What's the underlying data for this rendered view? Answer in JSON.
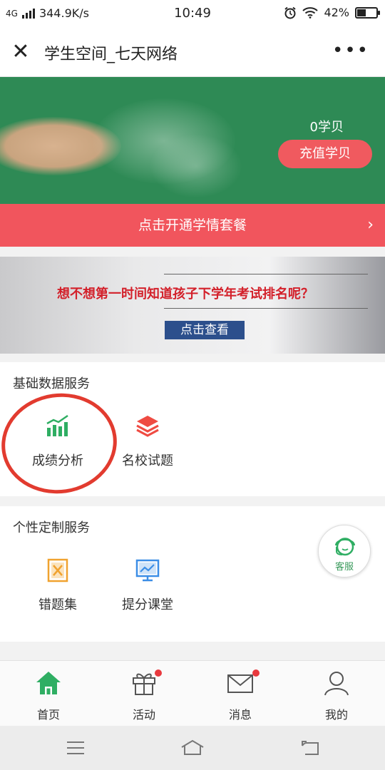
{
  "status_bar": {
    "network": "4G",
    "speed": "344.9K/s",
    "time": "10:49",
    "battery": "42%",
    "battery_level": 0.42,
    "icons": [
      "signal-icon",
      "alarm-icon",
      "wifi-icon",
      "battery-icon"
    ]
  },
  "titlebar": {
    "title": "学生空间_七天网络",
    "close_icon": "close-icon",
    "more_icon": "more-icon"
  },
  "banner": {
    "coins": "0学贝",
    "recharge_label": "充值学贝",
    "colors": {
      "background": "#2e8a55",
      "button": "#f05a5f"
    }
  },
  "promo": {
    "label": "点击开通学情套餐",
    "chevron_icon": "chevron-right-icon",
    "color": "#f1555d"
  },
  "ad": {
    "headline": "想不想第一时间知道孩子下学年考试排名呢？",
    "cta": "点击查看"
  },
  "basic_services": {
    "heading": "基础数据服务",
    "items": [
      {
        "label": "成绩分析",
        "icon": "bar-chart-icon",
        "color": "#2fae63"
      },
      {
        "label": "名校试题",
        "icon": "layers-icon",
        "color": "#ef4b42"
      }
    ]
  },
  "custom_services": {
    "heading": "个性定制服务",
    "items": [
      {
        "label": "错题集",
        "icon": "wrong-book-icon",
        "color": "#f0a22f"
      },
      {
        "label": "提分课堂",
        "icon": "monitor-icon",
        "color": "#3c8ee6"
      }
    ]
  },
  "customer_service": {
    "label": "客服",
    "icon": "agent-icon"
  },
  "tabbar": {
    "tabs": [
      {
        "label": "首页",
        "icon": "home-icon",
        "active": true,
        "dot": false
      },
      {
        "label": "活动",
        "icon": "gift-icon",
        "active": false,
        "dot": true
      },
      {
        "label": "消息",
        "icon": "mail-icon",
        "active": false,
        "dot": true
      },
      {
        "label": "我的",
        "icon": "user-icon",
        "active": false,
        "dot": false
      }
    ],
    "active_color": "#2fae63"
  },
  "system_nav": {
    "icons": [
      "menu-icon",
      "home-outline-icon",
      "back-icon"
    ]
  }
}
